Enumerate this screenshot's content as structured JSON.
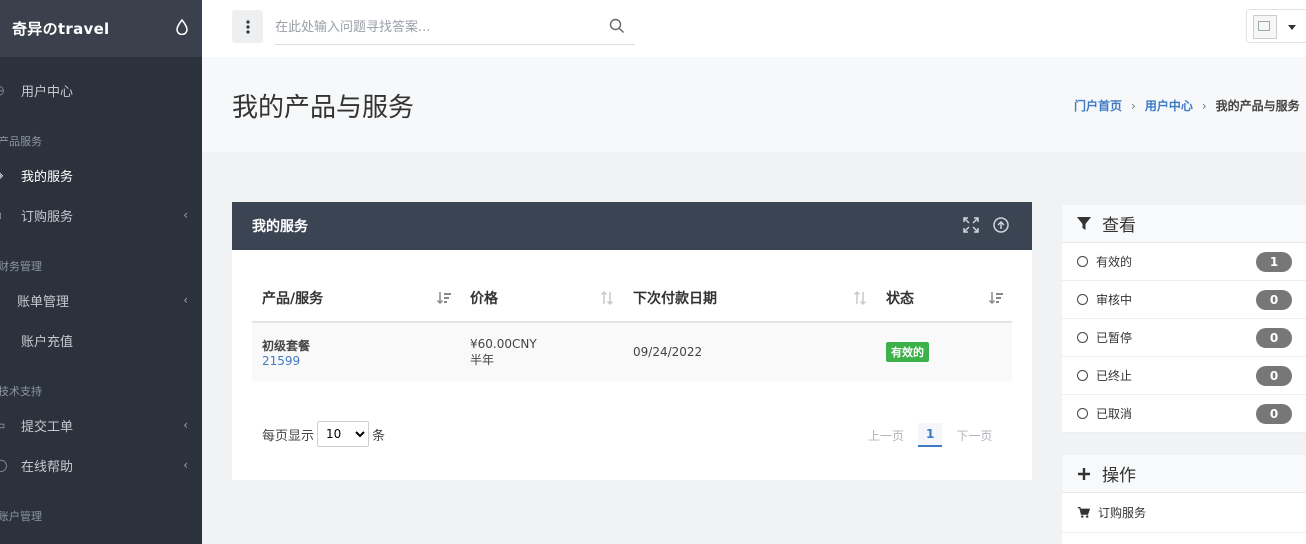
{
  "brand": {
    "name": "奇异のtravel"
  },
  "sidebar": {
    "items": [
      {
        "label": "用户中心"
      },
      {
        "section": "产品服务"
      },
      {
        "label": "我的服务"
      },
      {
        "label": "订购服务"
      },
      {
        "section": "财务管理"
      },
      {
        "label": "账单管理"
      },
      {
        "label": "账户充值"
      },
      {
        "section": "技术支持"
      },
      {
        "label": "提交工单"
      },
      {
        "label": "在线帮助"
      },
      {
        "section": "账户管理"
      }
    ]
  },
  "search": {
    "placeholder": "在此处输入问题寻找答案..."
  },
  "page": {
    "title": "我的产品与服务",
    "breadcrumb": [
      "门户首页",
      "用户中心",
      "我的产品与服务"
    ]
  },
  "panel": {
    "title": "我的服务",
    "columns": [
      "产品/服务",
      "价格",
      "下次付款日期",
      "状态"
    ],
    "rows": [
      {
        "product": "初级套餐",
        "id": "21599",
        "price": "¥60.00CNY",
        "cycle": "半年",
        "next_due": "09/24/2022",
        "status": "有效的"
      }
    ],
    "page_size_prefix": "每页显示",
    "page_size": "10",
    "page_size_suffix": "条",
    "pager": {
      "prev": "上一页",
      "current": "1",
      "next": "下一页"
    }
  },
  "filter": {
    "title": "查看",
    "items": [
      {
        "label": "有效的",
        "count": "1"
      },
      {
        "label": "审核中",
        "count": "0"
      },
      {
        "label": "已暂停",
        "count": "0"
      },
      {
        "label": "已终止",
        "count": "0"
      },
      {
        "label": "已取消",
        "count": "0"
      }
    ]
  },
  "actions": {
    "title": "操作",
    "items": [
      {
        "label": "订购服务"
      }
    ]
  },
  "colors": {
    "sidebar_bg": "#2b323b",
    "panel_head": "#3b4453",
    "link": "#3f7ac5",
    "success": "#3cb14a"
  }
}
